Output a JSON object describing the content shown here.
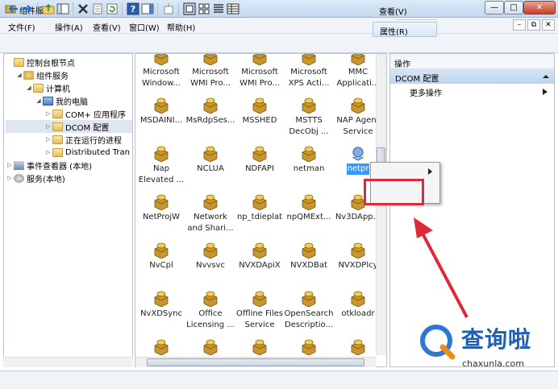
{
  "window": {
    "title": "组件服务",
    "min": "—",
    "max": "□",
    "close": "✕"
  },
  "menu": [
    "文件(F)",
    "操作(A)",
    "查看(V)",
    "窗口(W)",
    "帮助(H)"
  ],
  "mdi": [
    "–",
    "⧉",
    "✕"
  ],
  "tree": [
    {
      "label": "控制台根节点",
      "level": 0,
      "exp": ""
    },
    {
      "label": "组件服务",
      "level": 1,
      "exp": "◢"
    },
    {
      "label": "计算机",
      "level": 2,
      "exp": "◢"
    },
    {
      "label": "我的电脑",
      "level": 3,
      "exp": "◢"
    },
    {
      "label": "COM+ 应用程序",
      "level": 4,
      "exp": "▷"
    },
    {
      "label": "DCOM 配置",
      "level": 4,
      "exp": "▷",
      "selected": true
    },
    {
      "label": "正在运行的进程",
      "level": 4,
      "exp": "▷"
    },
    {
      "label": "Distributed Tran",
      "level": 4,
      "exp": "▷"
    },
    {
      "label": "事件查看器 (本地)",
      "level": 0,
      "exp": "▷"
    },
    {
      "label": "服务(本地)",
      "level": 0,
      "exp": "▷"
    }
  ],
  "items": [
    [
      "Microsoft\nWindow...",
      "Microsoft\nWMI Pro...",
      "Microsoft\nWMI Pro...",
      "Microsoft\nXPS Acti...",
      "MMC\nApplicati..."
    ],
    [
      "MSDAINI...",
      "MsRdpSes...",
      "MSSHED",
      "MSTTS\nDecObj ...",
      "NAP Agent\nService"
    ],
    [
      "Nap\nElevated ...",
      "NCLUA",
      "NDFAPI",
      "netman",
      "netpr"
    ],
    [
      "NetProjW",
      "Network\nand Shari...",
      "np_tdieplat",
      "npQMExt...",
      "Nv3DApp..."
    ],
    [
      "NvCpl",
      "Nvvsvc",
      "NVXDApiX",
      "NVXDBat",
      "NVXDPlcy"
    ],
    [
      "NvXDSync",
      "Office\nLicensing ...",
      "Offline Files\nService",
      "OpenSearch\nDescriptio...",
      "otkloadr"
    ],
    [
      "",
      "",
      "",
      "",
      ""
    ]
  ],
  "actions": {
    "header": "操作",
    "section": "DCOM 配置",
    "more": "更多操作"
  },
  "context_menu": {
    "view": "查看(V)",
    "properties": "属性(R)"
  },
  "watermark": {
    "text": "查询啦",
    "url": "chaxunla.com"
  }
}
